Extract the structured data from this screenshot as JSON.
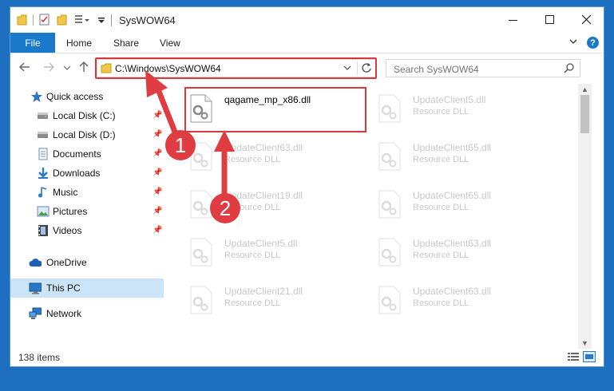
{
  "window": {
    "title": "SysWOW64"
  },
  "ribbon": {
    "tabs": [
      "File",
      "Home",
      "Share",
      "View"
    ]
  },
  "address": {
    "path": "C:\\Windows\\SysWOW64"
  },
  "search": {
    "placeholder": "Search SysWOW64"
  },
  "nav": {
    "quick_access": "Quick access",
    "items": [
      {
        "label": "Local Disk (C:)",
        "icon": "drive-icon"
      },
      {
        "label": "Local Disk (D:)",
        "icon": "drive-icon"
      },
      {
        "label": "Documents",
        "icon": "documents-icon"
      },
      {
        "label": "Downloads",
        "icon": "downloads-icon"
      },
      {
        "label": "Music",
        "icon": "music-icon"
      },
      {
        "label": "Pictures",
        "icon": "pictures-icon"
      },
      {
        "label": "Videos",
        "icon": "videos-icon"
      }
    ],
    "onedrive": "OneDrive",
    "this_pc": "This PC",
    "network": "Network"
  },
  "files": [
    {
      "name": "qagame_mp_x86.dll",
      "type": ""
    },
    {
      "name": "UpdateClient5.dll",
      "type": "Resource DLL"
    },
    {
      "name": "UpdateClient63.dll",
      "type": "Resource DLL"
    },
    {
      "name": "UpdateClient65.dll",
      "type": "Resource DLL"
    },
    {
      "name": "UpdateClient19.dll",
      "type": "Resource DLL"
    },
    {
      "name": "UpdateClient65.dll",
      "type": "Resource DLL"
    },
    {
      "name": "UpdateClient5.dll",
      "type": "Resource DLL"
    },
    {
      "name": "UpdateClient63.dll",
      "type": "Resource DLL"
    },
    {
      "name": "UpdateClient21.dll",
      "type": "Resource DLL"
    },
    {
      "name": "UpdateClient63.dll",
      "type": "Resource DLL"
    }
  ],
  "status": {
    "item_count": "138 items"
  },
  "callouts": [
    "1",
    "2"
  ],
  "colors": {
    "accent": "#1979ca",
    "highlight": "#d9393e"
  }
}
